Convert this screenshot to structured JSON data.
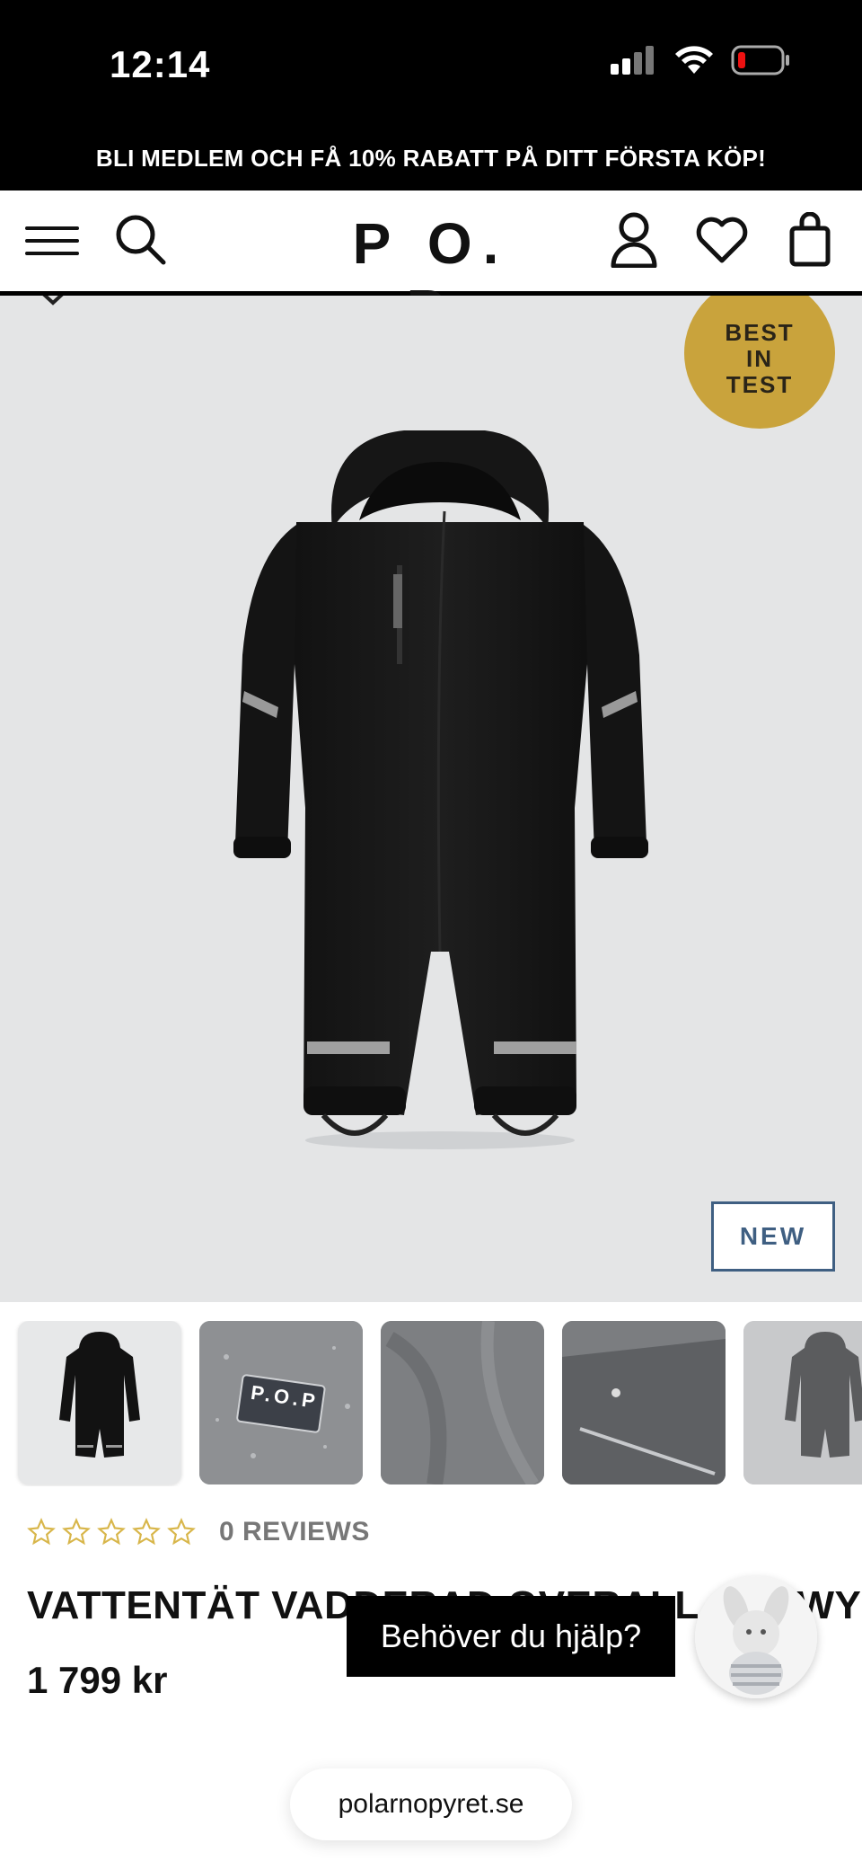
{
  "status_bar": {
    "time": "12:14"
  },
  "promo_banner": {
    "text": "BLI MEDLEM OCH FÅ 10% RABATT PÅ DITT FÖRSTA KÖP!"
  },
  "header": {
    "logo": "P O. P"
  },
  "product": {
    "badge_best": [
      "BEST",
      "IN",
      "TEST"
    ],
    "badge_new": "NEW",
    "rating_count": "0 REVIEWS",
    "stars_filled": 0,
    "stars_total": 5,
    "title": "VATTENTÄT VADDERAD OVERALL SNOWY",
    "price": "1 799 kr",
    "thumbnail_patch_text": "P.O.P"
  },
  "help_chat": {
    "label": "Behöver du hjälp?"
  },
  "browser": {
    "url": "polarnopyret.se"
  },
  "colors": {
    "badge_best": "#c9a33c",
    "badge_new": "#3f5f82",
    "star": "#d8b64a",
    "banner": "#000000"
  }
}
